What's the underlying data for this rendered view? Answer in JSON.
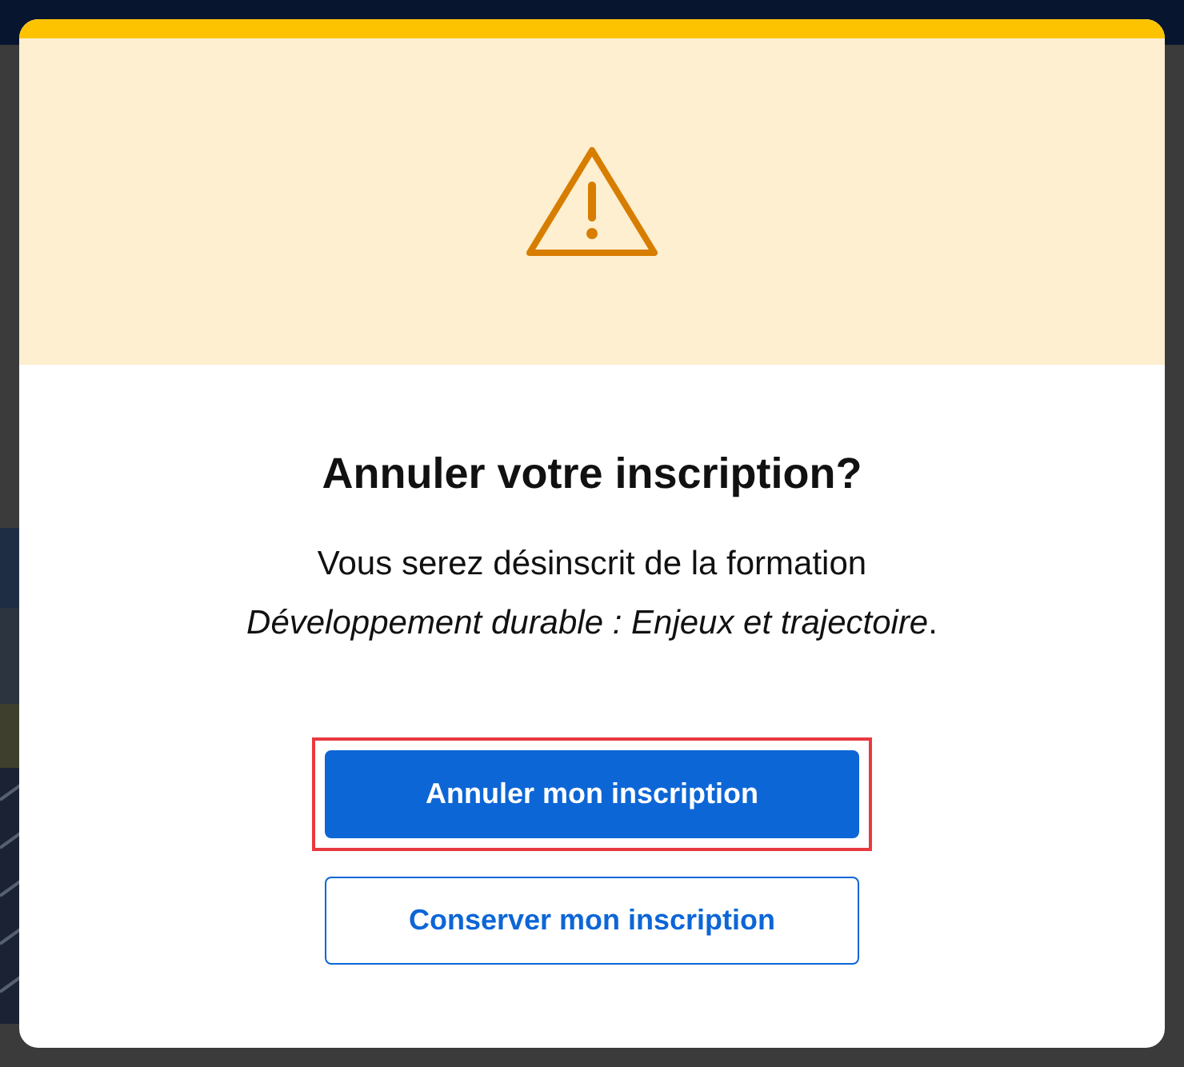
{
  "dialog": {
    "title": "Annuler votre inscription?",
    "message_lines": [
      "Vous serez désinscrit de la formation",
      "*Développement durable : Enjeux et trajectoire*."
    ],
    "buttons": [
      {
        "label": "Annuler mon inscription",
        "kind": "primary",
        "focused": true
      },
      {
        "label": "Conserver mon inscription",
        "kind": "secondary",
        "focused": false
      }
    ]
  }
}
